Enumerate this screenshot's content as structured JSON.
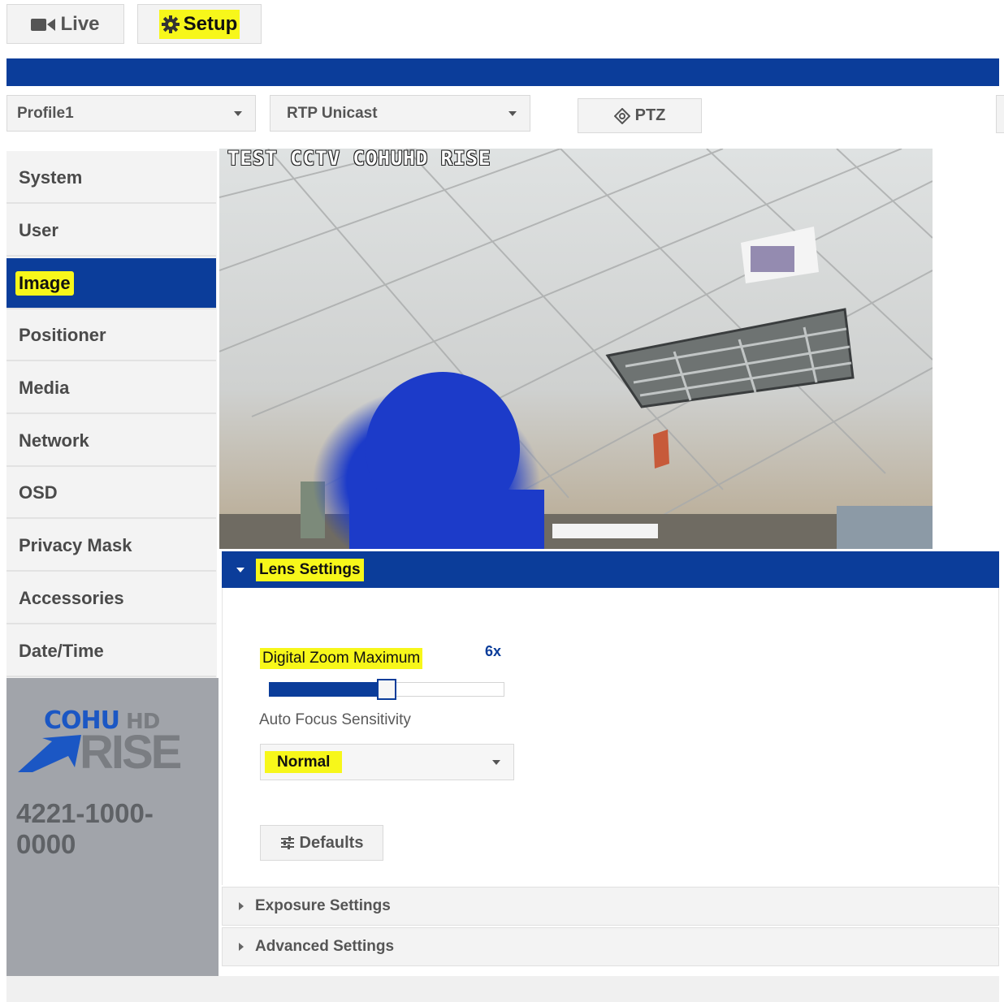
{
  "top_nav": {
    "live_label": "Live",
    "setup_label": "Setup"
  },
  "toolbar": {
    "profile_select": "Profile1",
    "stream_select": "RTP Unicast",
    "ptz_label": "PTZ"
  },
  "sidebar": {
    "items": [
      {
        "label": "System"
      },
      {
        "label": "User"
      },
      {
        "label": "Image"
      },
      {
        "label": "Positioner"
      },
      {
        "label": "Media"
      },
      {
        "label": "Network"
      },
      {
        "label": "OSD"
      },
      {
        "label": "Privacy Mask"
      },
      {
        "label": "Accessories"
      },
      {
        "label": "Date/Time"
      }
    ],
    "active_item": "Image",
    "brand": {
      "logo_line1": "COHU",
      "logo_line1_suffix": "HD",
      "logo_line2": "RISE",
      "model_number": "4221-1000-\n0000"
    }
  },
  "camera_feed": {
    "overlay_text": "TEST CCTV COHUHD RISE"
  },
  "lens_settings": {
    "title": "Lens Settings",
    "digital_zoom": {
      "label": "Digital Zoom Maximum",
      "value_text": "6x",
      "slider_fraction": 0.5
    },
    "auto_focus": {
      "label": "Auto Focus Sensitivity",
      "selected": "Normal"
    },
    "defaults_label": "Defaults"
  },
  "collapsed_sections": [
    {
      "label": "Exposure Settings"
    },
    {
      "label": "Advanced Settings"
    }
  ],
  "colors": {
    "brand_blue": "#0b3d9a",
    "highlight_yellow": "#f7f71a",
    "sidebar_gray": "#a1a4aa"
  }
}
